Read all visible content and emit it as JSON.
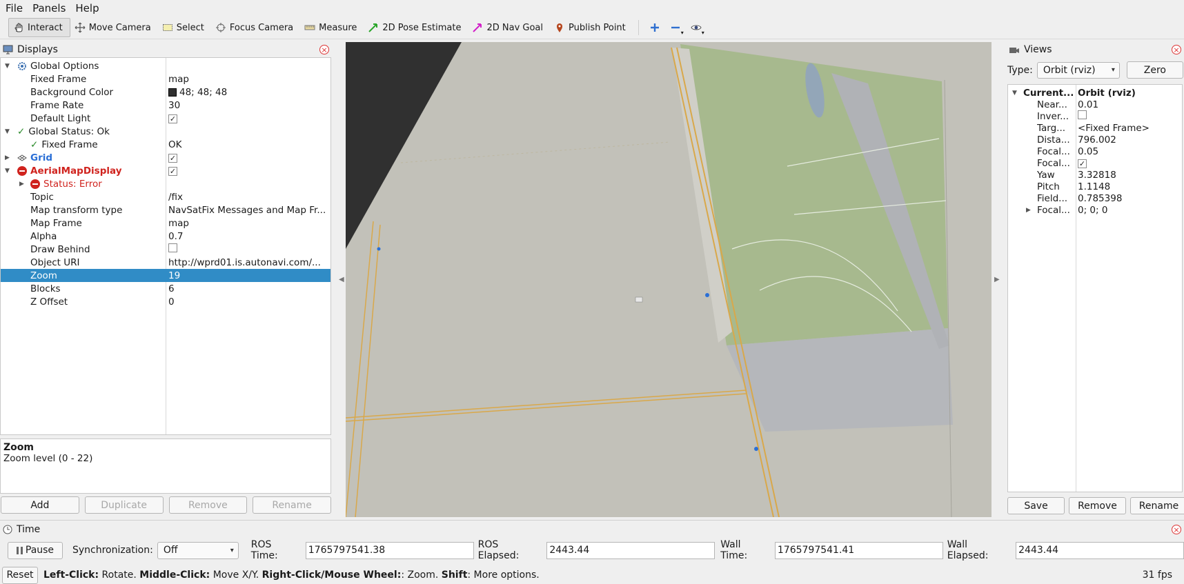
{
  "menu": [
    "File",
    "Panels",
    "Help"
  ],
  "toolbar": {
    "tools": [
      "Interact",
      "Move Camera",
      "Select",
      "Focus Camera",
      "Measure",
      "2D Pose Estimate",
      "2D Nav Goal",
      "Publish Point"
    ],
    "icons": [
      "plus-icon",
      "minus-icon",
      "eye-icon"
    ]
  },
  "displays": {
    "title": "Displays",
    "rows": [
      {
        "name": "Global Options",
        "value": ""
      },
      {
        "name": "Fixed Frame",
        "value": "map"
      },
      {
        "name": "Background Color",
        "value": "48; 48; 48"
      },
      {
        "name": "Frame Rate",
        "value": "30"
      },
      {
        "name": "Default Light",
        "value": ""
      },
      {
        "name": "Global Status: Ok",
        "value": ""
      },
      {
        "name": "Fixed Frame",
        "value": "OK"
      },
      {
        "name": "Grid",
        "value": ""
      },
      {
        "name": "AerialMapDisplay",
        "value": ""
      },
      {
        "name": "Status: Error",
        "value": ""
      },
      {
        "name": "Topic",
        "value": "/fix"
      },
      {
        "name": "Map transform type",
        "value": "NavSatFix Messages and Map Fr..."
      },
      {
        "name": "Map Frame",
        "value": "map"
      },
      {
        "name": "Alpha",
        "value": "0.7"
      },
      {
        "name": "Draw Behind",
        "value": ""
      },
      {
        "name": "Object URI",
        "value": "http://wprd01.is.autonavi.com/..."
      },
      {
        "name": "Zoom",
        "value": "19"
      },
      {
        "name": "Blocks",
        "value": "6"
      },
      {
        "name": "Z Offset",
        "value": "0"
      }
    ],
    "description_title": "Zoom",
    "description_text": "Zoom level (0 - 22)",
    "buttons": [
      "Add",
      "Duplicate",
      "Remove",
      "Rename"
    ]
  },
  "views": {
    "title": "Views",
    "type_label": "Type:",
    "type_value": "Orbit (rviz)",
    "zero_label": "Zero",
    "rows": [
      {
        "name": "Current...",
        "value": "Orbit (rviz)"
      },
      {
        "name": "Near...",
        "value": "0.01"
      },
      {
        "name": "Inver...",
        "value": ""
      },
      {
        "name": "Targ...",
        "value": "<Fixed Frame>"
      },
      {
        "name": "Dista...",
        "value": "796.002"
      },
      {
        "name": "Focal...",
        "value": "0.05"
      },
      {
        "name": "Focal...",
        "value": ""
      },
      {
        "name": "Yaw",
        "value": "3.32818"
      },
      {
        "name": "Pitch",
        "value": "1.1148"
      },
      {
        "name": "Field...",
        "value": "0.785398"
      },
      {
        "name": "Focal...",
        "value": "0; 0; 0"
      }
    ],
    "buttons": [
      "Save",
      "Remove",
      "Rename"
    ]
  },
  "time": {
    "title": "Time",
    "pause_label": "Pause",
    "sync_label": "Synchronization:",
    "sync_value": "Off",
    "ros_time_label": "ROS Time:",
    "ros_time": "1765797541.38",
    "ros_elapsed_label": "ROS Elapsed:",
    "ros_elapsed": "2443.44",
    "wall_time_label": "Wall Time:",
    "wall_time": "1765797541.41",
    "wall_elapsed_label": "Wall Elapsed:",
    "wall_elapsed": "2443.44"
  },
  "status": {
    "reset_label": "Reset",
    "hint_parts": [
      "Left-Click:",
      " Rotate. ",
      "Middle-Click:",
      " Move X/Y. ",
      "Right-Click/Mouse Wheel:",
      ": Zoom. ",
      "Shift",
      ": More options."
    ],
    "fps": "31 fps"
  },
  "colors": {
    "background": "#303030",
    "map_ground": "#c2c1b9",
    "park": "#a7b98e",
    "selection": "#308cc6"
  }
}
